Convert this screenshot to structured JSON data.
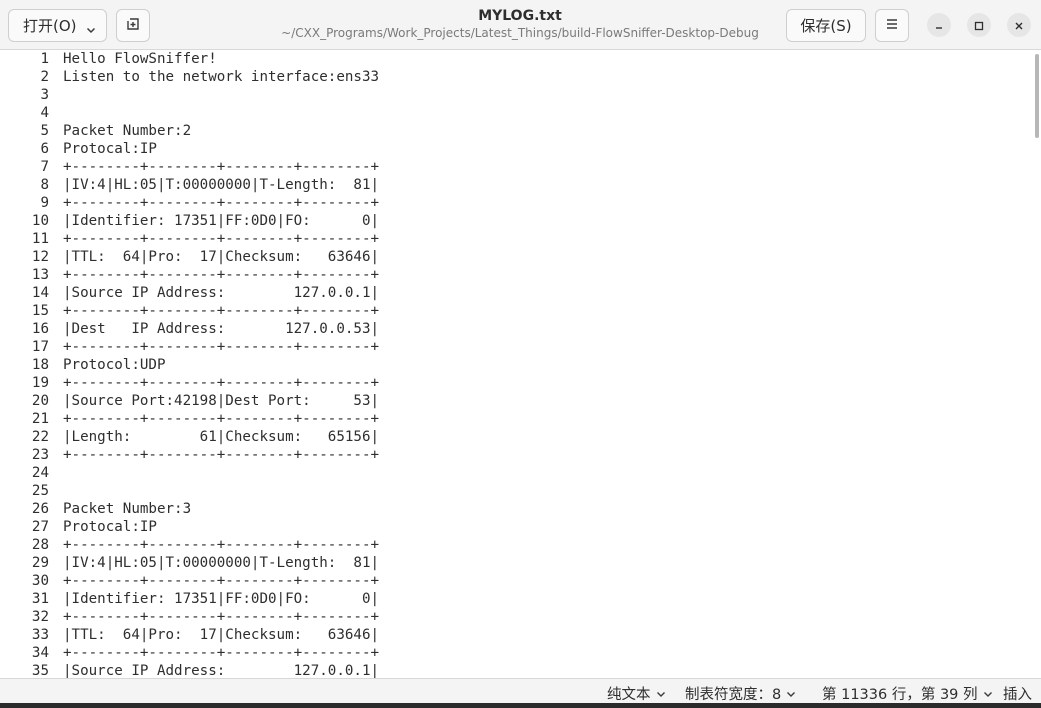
{
  "header": {
    "open_label": "打开(O)",
    "save_label": "保存(S)",
    "title": "MYLOG.txt",
    "subtitle": "~/CXX_Programs/Work_Projects/Latest_Things/build-FlowSniffer-Desktop-Debug",
    "icons": {
      "open_dropdown": "chevron-down-icon",
      "new_tab": "new-tab-icon",
      "menu": "hamburger-menu-icon",
      "minimize": "minimize-icon",
      "maximize": "maximize-icon",
      "close": "close-icon"
    }
  },
  "editor": {
    "lines": [
      {
        "num": "1",
        "text": "Hello FlowSniffer!"
      },
      {
        "num": "2",
        "text": "Listen to the network interface:ens33"
      },
      {
        "num": "3",
        "text": ""
      },
      {
        "num": "4",
        "text": ""
      },
      {
        "num": "5",
        "text": "Packet Number:2"
      },
      {
        "num": "6",
        "text": "Protocal:IP"
      },
      {
        "num": "7",
        "text": "+--------+--------+--------+--------+"
      },
      {
        "num": "8",
        "text": "|IV:4|HL:05|T:00000000|T-Length:  81|"
      },
      {
        "num": "9",
        "text": "+--------+--------+--------+--------+"
      },
      {
        "num": "10",
        "text": "|Identifier: 17351|FF:0D0|FO:      0|"
      },
      {
        "num": "11",
        "text": "+--------+--------+--------+--------+"
      },
      {
        "num": "12",
        "text": "|TTL:  64|Pro:  17|Checksum:   63646|"
      },
      {
        "num": "13",
        "text": "+--------+--------+--------+--------+"
      },
      {
        "num": "14",
        "text": "|Source IP Address:        127.0.0.1|"
      },
      {
        "num": "15",
        "text": "+--------+--------+--------+--------+"
      },
      {
        "num": "16",
        "text": "|Dest   IP Address:       127.0.0.53|"
      },
      {
        "num": "17",
        "text": "+--------+--------+--------+--------+"
      },
      {
        "num": "18",
        "text": "Protocol:UDP"
      },
      {
        "num": "19",
        "text": "+--------+--------+--------+--------+"
      },
      {
        "num": "20",
        "text": "|Source Port:42198|Dest Port:     53|"
      },
      {
        "num": "21",
        "text": "+--------+--------+--------+--------+"
      },
      {
        "num": "22",
        "text": "|Length:        61|Checksum:   65156|"
      },
      {
        "num": "23",
        "text": "+--------+--------+--------+--------+"
      },
      {
        "num": "24",
        "text": ""
      },
      {
        "num": "25",
        "text": ""
      },
      {
        "num": "26",
        "text": "Packet Number:3"
      },
      {
        "num": "27",
        "text": "Protocal:IP"
      },
      {
        "num": "28",
        "text": "+--------+--------+--------+--------+"
      },
      {
        "num": "29",
        "text": "|IV:4|HL:05|T:00000000|T-Length:  81|"
      },
      {
        "num": "30",
        "text": "+--------+--------+--------+--------+"
      },
      {
        "num": "31",
        "text": "|Identifier: 17351|FF:0D0|FO:      0|"
      },
      {
        "num": "32",
        "text": "+--------+--------+--------+--------+"
      },
      {
        "num": "33",
        "text": "|TTL:  64|Pro:  17|Checksum:   63646|"
      },
      {
        "num": "34",
        "text": "+--------+--------+--------+--------+"
      },
      {
        "num": "35",
        "text": "|Source IP Address:        127.0.0.1|"
      }
    ]
  },
  "statusbar": {
    "language": "纯文本",
    "tab_width": "制表符宽度：8",
    "cursor_position": "第 11336 行，第 39 列",
    "insert_mode": "插入"
  }
}
